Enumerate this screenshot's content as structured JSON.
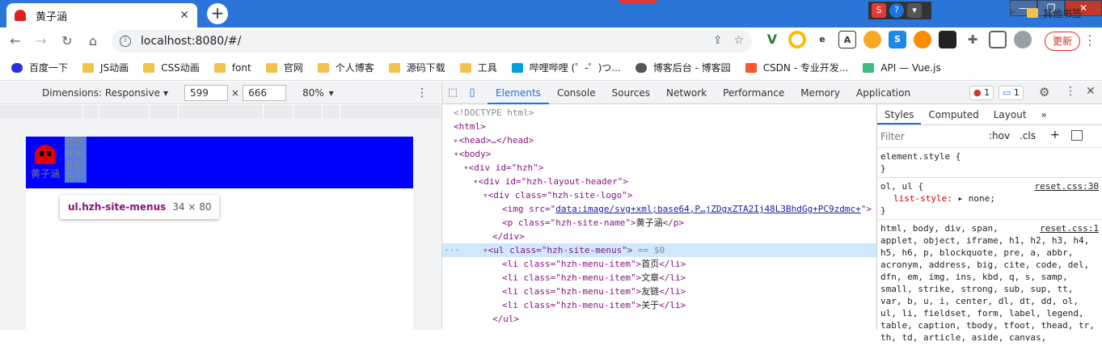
{
  "browser": {
    "tab_title": "黄子涵",
    "tab_close": "✕",
    "new_tab": "+",
    "window_controls": {
      "minimize": "—",
      "restore": "❐",
      "close": "✕"
    },
    "ime_label": "S",
    "url": "localhost:8080/#/",
    "update_label": "更新",
    "bookmarks": [
      "百度一下",
      "JS动画",
      "CSS动画",
      "font",
      "官网",
      "个人博客",
      "源码下载",
      "工具",
      "哔哩哔哩 (゜-゜)つ...",
      "博客后台 - 博客园",
      "CSDN - 专业开发...",
      "API — Vue.js"
    ],
    "bookmarks_more": "»",
    "other_bookmarks": "其他书签"
  },
  "device_toolbar": {
    "dimensions_label": "Dimensions: Responsive",
    "width": "599",
    "height": "666",
    "times": "×",
    "zoom": "80%"
  },
  "page": {
    "site_name": "黄子涵",
    "menu_items": [
      "首页",
      "文章",
      "友链",
      "关于"
    ],
    "tooltip_tag": "ul.hzh-site-menus",
    "tooltip_dim": "34 × 80"
  },
  "devtools": {
    "tabs": [
      "Elements",
      "Console",
      "Sources",
      "Network",
      "Performance",
      "Memory",
      "Application"
    ],
    "active_tab": "Elements",
    "error_count": "1",
    "message_count": "1",
    "dom": {
      "doctype": "<!DOCTYPE html>",
      "html": "<html>",
      "head": "<head>…</head>",
      "body": "<body>",
      "hzh_open": "<div id=\"hzh\">",
      "header_open": "<div id=\"hzh-layout-header\">",
      "logo_open": "<div class=\"hzh-site-logo\">",
      "img_tag_start": "<img src=\"",
      "img_src": "data:image/svg+xml;base64,P…jZDgxZTA2Ij48L3BhdGg+PC9zdmc+",
      "img_tag_end": "\">",
      "p_open": "<p class=\"hzh-site-name\">",
      "p_text": "黄子涵",
      "p_close": "</p>",
      "div_close": "</div>",
      "ul_open": "<ul class=\"hzh-site-menus\">",
      "ul_suffix": "== $0",
      "li_open": "<li class=\"hzh-menu-item\">",
      "li_close": "</li>",
      "li_texts": [
        "首页",
        "文章",
        "友链",
        "关于"
      ],
      "ul_close": "</ul>"
    },
    "styles_tabs": [
      "Styles",
      "Computed",
      "Layout"
    ],
    "styles_more": "»",
    "filter_placeholder": "Filter",
    "hov": ":hov",
    "cls": ".cls",
    "rules": {
      "element_style": "element.style {",
      "brace_close": "}",
      "ol_ul": "ol, ul {",
      "ol_ul_src": "reset.css:30",
      "list_style_prop": "list-style:",
      "list_style_val": "none;",
      "html_src": "reset.css:1",
      "html_selector": "html, body, div, span, applet, object, iframe, h1, h2, h3, h4, h5, h6, p, blockquote, pre, a, abbr, acronym, address, big, cite, code, del, dfn, em, img, ins, kbd, q, s, samp, small, strike, strong, sub, sup, tt, var, b, u, i, center, dl, dt, dd, ol, ul, li, fieldset, form, label, legend, table, caption, tbody, tfoot, thead, tr, th, td, article, aside, canvas,"
    }
  }
}
